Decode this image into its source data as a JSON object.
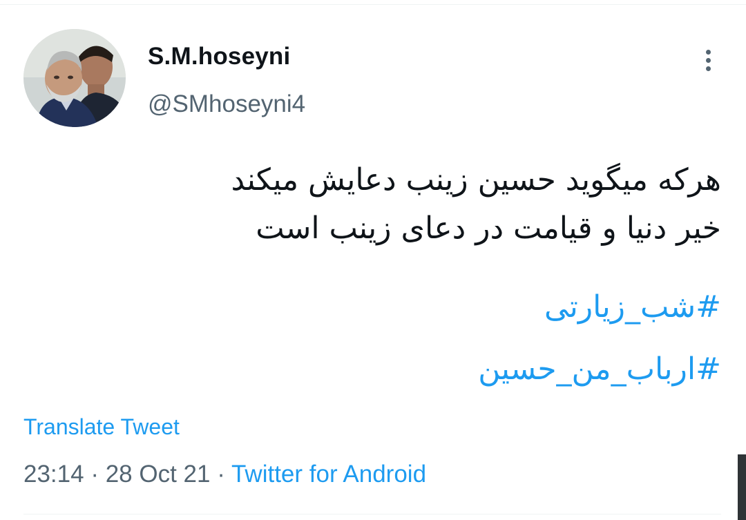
{
  "tweet": {
    "author": {
      "display_name": "S.M.hoseyni",
      "handle": "@SMhoseyni4",
      "avatar": "profile-photo"
    },
    "more_icon": "more-vertical-icon",
    "text_lines": [
      "هرکه میگوید حسین زینب دعایش میکند",
      "خیر دنیا و قیامت در دعای زینب است"
    ],
    "hashtags": [
      "#شب_زیارتی",
      "#ارباب_من_حسین"
    ],
    "translate_label": "Translate Tweet",
    "time": "23:14",
    "date": "28 Oct 21",
    "separator": "·",
    "source": "Twitter for Android"
  },
  "colors": {
    "link": "#1d9bf0",
    "secondary_text": "#536471",
    "primary_text": "#0f1419",
    "divider": "#eff3f4"
  }
}
